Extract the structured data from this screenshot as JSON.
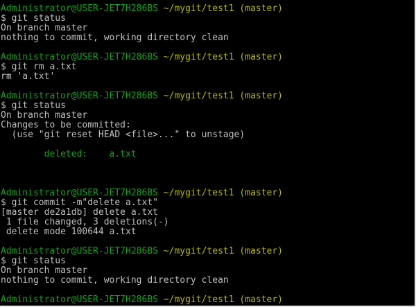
{
  "terminal": {
    "prompt_user_host": "Administrator@USER-JET7H286BS",
    "prompt_path": "~/mygit/test1",
    "prompt_branch": "(master)",
    "prompt_symbol": "$",
    "blocks": [
      {
        "command": " git status",
        "output": [
          {
            "text": "On branch master",
            "color": "white"
          },
          {
            "text": "nothing to commit, working directory clean",
            "color": "white"
          }
        ]
      },
      {
        "command": " git rm a.txt",
        "output": [
          {
            "text": "rm 'a.txt'",
            "color": "white"
          }
        ]
      },
      {
        "command": " git status",
        "output": [
          {
            "text": "On branch master",
            "color": "white"
          },
          {
            "text": "Changes to be committed:",
            "color": "white"
          },
          {
            "text": "  (use \"git reset HEAD <file>...\" to unstage)",
            "color": "white"
          },
          {
            "text": "",
            "color": "white"
          },
          {
            "text": "        deleted:    a.txt",
            "color": "green"
          },
          {
            "text": "",
            "color": "white"
          },
          {
            "text": "",
            "color": "white"
          }
        ]
      },
      {
        "command": " git commit -m\"delete a.txt\"",
        "output": [
          {
            "text": "[master de2a1db] delete a.txt",
            "color": "white"
          },
          {
            "text": " 1 file changed, 3 deletions(-)",
            "color": "white"
          },
          {
            "text": " delete mode 100644 a.txt",
            "color": "white"
          }
        ]
      },
      {
        "command": " git status",
        "output": [
          {
            "text": "On branch master",
            "color": "white"
          },
          {
            "text": "nothing to commit, working directory clean",
            "color": "white"
          }
        ]
      }
    ],
    "final_prompt_symbol": "$",
    "colors": {
      "background": "#000000",
      "text": "#c0c0c0",
      "user_host": "#12a51a",
      "path": "#bbbb00",
      "deleted": "#12a51a"
    }
  }
}
